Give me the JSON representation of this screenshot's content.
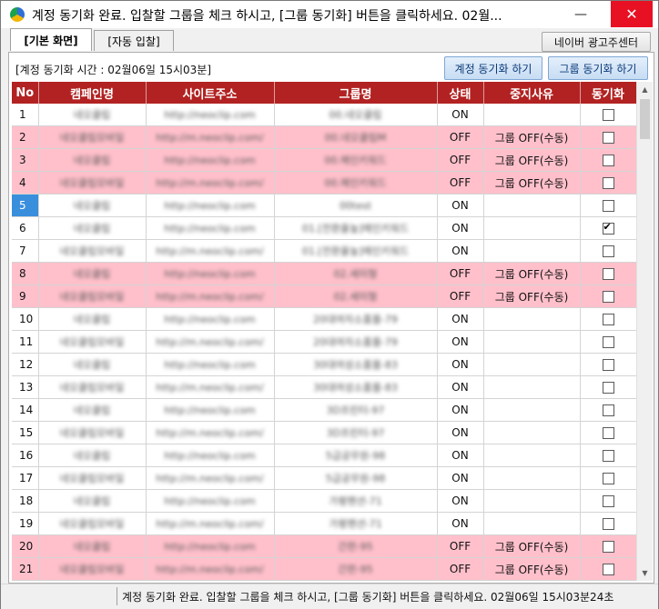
{
  "window": {
    "title": "계정 동기화 완료. 입찰할 그룹을 체크 하시고, [그룹 동기화] 버튼을 클릭하세요. 02월...",
    "minimize_glyph": "—",
    "close_glyph": "✕"
  },
  "tabs": [
    {
      "label": "[기본 화면]",
      "active": true
    },
    {
      "label": "[자동 입찰]",
      "active": false
    }
  ],
  "toolbar": {
    "naver_ad_center": "네이버 광고주센터",
    "sync_time": "[계정 동기화 시간 : 02월06일 15시03분]",
    "sync_account": "계정 동기화 하기",
    "sync_group": "그룹 동기화 하기"
  },
  "table": {
    "columns": [
      "No",
      "캠페인명",
      "사이트주소",
      "그룹명",
      "상태",
      "중지사유",
      "동기화"
    ],
    "rows": [
      {
        "no": "1",
        "campaign": "네오클립",
        "site": "http://neoclip.com",
        "group": "00.네오클립",
        "status": "ON",
        "reason": "",
        "checked": false,
        "pink": false
      },
      {
        "no": "2",
        "campaign": "네오클립모바일",
        "site": "http://m.neoclip.com/",
        "group": "00.네오클립M",
        "status": "OFF",
        "reason": "그룹 OFF(수동)",
        "checked": false,
        "pink": true
      },
      {
        "no": "3",
        "campaign": "네오클립",
        "site": "http://neoclip.com",
        "group": "00.메인키워드",
        "status": "OFF",
        "reason": "그룹 OFF(수동)",
        "checked": false,
        "pink": true
      },
      {
        "no": "4",
        "campaign": "네오클립모바일",
        "site": "http://m.neoclip.com/",
        "group": "00.메인키워드",
        "status": "OFF",
        "reason": "그룹 OFF(수동)",
        "checked": false,
        "pink": true
      },
      {
        "no": "5",
        "campaign": "네오클립",
        "site": "http://neoclip.com",
        "group": "00test",
        "status": "ON",
        "reason": "",
        "checked": false,
        "pink": false,
        "selected": true
      },
      {
        "no": "6",
        "campaign": "네오클립",
        "site": "http://neoclip.com",
        "group": "01.[전환율높]메인키워드",
        "status": "ON",
        "reason": "",
        "checked": true,
        "pink": false
      },
      {
        "no": "7",
        "campaign": "네오클립모바일",
        "site": "http://m.neoclip.com/",
        "group": "01.[전환율높]메인키워드",
        "status": "ON",
        "reason": "",
        "checked": false,
        "pink": false
      },
      {
        "no": "8",
        "campaign": "네오클립",
        "site": "http://neoclip.com",
        "group": "02.세미형",
        "status": "OFF",
        "reason": "그룹 OFF(수동)",
        "checked": false,
        "pink": true
      },
      {
        "no": "9",
        "campaign": "네오클립모바일",
        "site": "http://m.neoclip.com/",
        "group": "02.세미형",
        "status": "OFF",
        "reason": "그룹 OFF(수동)",
        "checked": false,
        "pink": true
      },
      {
        "no": "10",
        "campaign": "네오클립",
        "site": "http://neoclip.com",
        "group": "20대여자소품몰-79",
        "status": "ON",
        "reason": "",
        "checked": false,
        "pink": false
      },
      {
        "no": "11",
        "campaign": "네오클립모바일",
        "site": "http://m.neoclip.com/",
        "group": "20대여자소품몰-79",
        "status": "ON",
        "reason": "",
        "checked": false,
        "pink": false
      },
      {
        "no": "12",
        "campaign": "네오클립",
        "site": "http://neoclip.com",
        "group": "30대여성소품몰-83",
        "status": "ON",
        "reason": "",
        "checked": false,
        "pink": false
      },
      {
        "no": "13",
        "campaign": "네오클립모바일",
        "site": "http://m.neoclip.com/",
        "group": "30대여성소품몰-83",
        "status": "ON",
        "reason": "",
        "checked": false,
        "pink": false
      },
      {
        "no": "14",
        "campaign": "네오클립",
        "site": "http://neoclip.com",
        "group": "3D프린터-97",
        "status": "ON",
        "reason": "",
        "checked": false,
        "pink": false
      },
      {
        "no": "15",
        "campaign": "네오클립모바일",
        "site": "http://m.neoclip.com/",
        "group": "3D프린터-97",
        "status": "ON",
        "reason": "",
        "checked": false,
        "pink": false
      },
      {
        "no": "16",
        "campaign": "네오클립",
        "site": "http://neoclip.com",
        "group": "5급공무원-98",
        "status": "ON",
        "reason": "",
        "checked": false,
        "pink": false
      },
      {
        "no": "17",
        "campaign": "네오클립모바일",
        "site": "http://m.neoclip.com/",
        "group": "5급공무원-98",
        "status": "ON",
        "reason": "",
        "checked": false,
        "pink": false
      },
      {
        "no": "18",
        "campaign": "네오클립",
        "site": "http://neoclip.com",
        "group": "가평펜션-71",
        "status": "ON",
        "reason": "",
        "checked": false,
        "pink": false
      },
      {
        "no": "19",
        "campaign": "네오클립모바일",
        "site": "http://m.neoclip.com/",
        "group": "가평펜션-71",
        "status": "ON",
        "reason": "",
        "checked": false,
        "pink": false
      },
      {
        "no": "20",
        "campaign": "네오클립",
        "site": "http://neoclip.com",
        "group": "간판-95",
        "status": "OFF",
        "reason": "그룹 OFF(수동)",
        "checked": false,
        "pink": true
      },
      {
        "no": "21",
        "campaign": "네오클립모바일",
        "site": "http://m.neoclip.com/",
        "group": "간판-95",
        "status": "OFF",
        "reason": "그룹 OFF(수동)",
        "checked": false,
        "pink": true
      }
    ]
  },
  "scrollbar": {
    "up": "▲",
    "down": "▼"
  },
  "statusbar": {
    "message": "계정 동기화 완료. 입찰할 그룹을 체크 하시고, [그룹 동기화] 버튼을 클릭하세요. 02월06일 15시03분24초"
  },
  "colors": {
    "header_bg": "#b22222",
    "pink_row": "#ffc0cb",
    "selected": "#3a8fdc"
  }
}
